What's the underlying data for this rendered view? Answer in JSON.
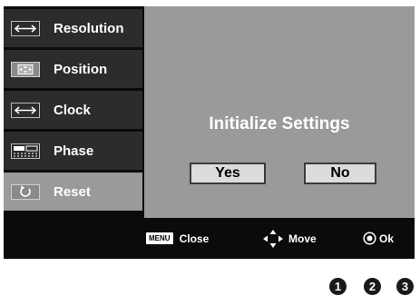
{
  "menu": {
    "items": [
      {
        "label": "Resolution",
        "icon": "resolution-icon"
      },
      {
        "label": "Position",
        "icon": "position-icon"
      },
      {
        "label": "Clock",
        "icon": "clock-icon"
      },
      {
        "label": "Phase",
        "icon": "phase-icon"
      },
      {
        "label": "Reset",
        "icon": "reset-icon",
        "selected": true
      }
    ]
  },
  "dialog": {
    "title": "Initialize Settings",
    "yes_label": "Yes",
    "no_label": "No"
  },
  "footer": {
    "menu_key": "MENU",
    "close_label": "Close",
    "move_label": "Move",
    "ok_label": "Ok"
  },
  "callouts": [
    "1",
    "2",
    "3"
  ],
  "colors": {
    "frame": "#0b0b0b",
    "menu_item": "#2c2c2c",
    "selected": "#9a9a9a",
    "button": "#dcdcdc"
  }
}
